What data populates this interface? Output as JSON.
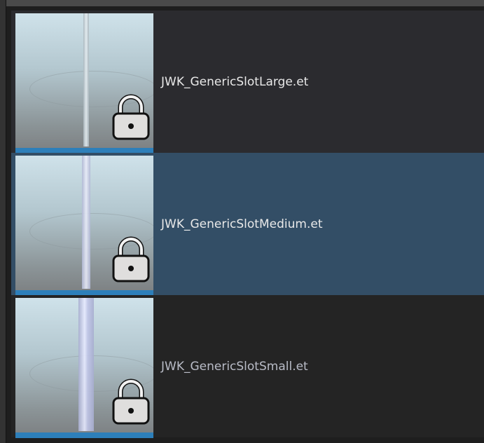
{
  "items": [
    {
      "label": "JWK_GenericSlotLarge.et",
      "thumbnail": "lock-icon",
      "selected": false
    },
    {
      "label": "JWK_GenericSlotMedium.et",
      "thumbnail": "lock-icon",
      "selected": true
    },
    {
      "label": "JWK_GenericSlotSmall.et",
      "thumbnail": "lock-icon",
      "selected": false
    }
  ],
  "colors": {
    "selected_row": "#334e66",
    "row": "#2b2b2f",
    "thumbnail_bar": "#2d7fba"
  }
}
